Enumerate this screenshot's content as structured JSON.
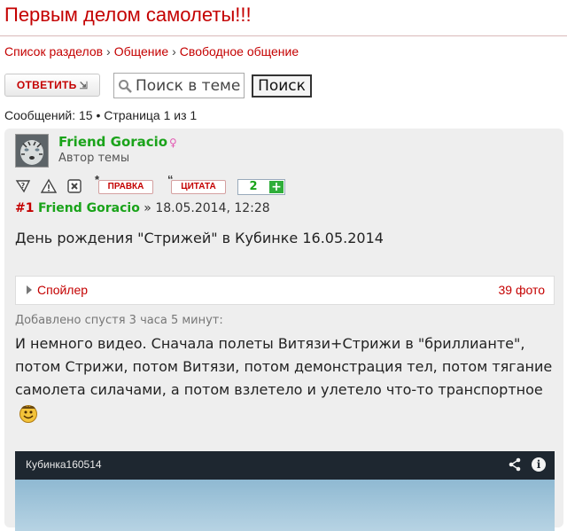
{
  "page": {
    "title": "Первым делом самолеты!!!"
  },
  "breadcrumb": {
    "items": [
      "Список разделов",
      "Общение",
      "Свободное общение"
    ],
    "separator": "›"
  },
  "toolbar": {
    "reply_label": "ОТВЕТИТЬ",
    "search_placeholder": "Поиск в теме...",
    "search_button": "Поиск"
  },
  "pagination": {
    "text": "Сообщений: 15 • Страница 1 из 1"
  },
  "post": {
    "author": "Friend Goracio",
    "gender_icon": "female-icon",
    "role": "Автор темы",
    "actions": {
      "edit_label": "ПРАВКА",
      "quote_label": "ЦИТАТА",
      "rating": "2",
      "rating_plus": "+"
    },
    "meta": {
      "number": "#1",
      "author": "Friend Goracio",
      "date": "» 18.05.2014, 12:28"
    },
    "text1": "День рождения \"Стрижей\" в Кубинке 16.05.2014",
    "spoiler": {
      "label": "Спойлер",
      "count": "39 фото"
    },
    "added_note": "Добавлено спустя 3 часа 5 минут:",
    "text2": "И немного видео. Сначала полеты Витязи+Стрижи в \"бриллианте\", потом Стрижи, потом Витязи, потом демонстрация тел, потом тягание самолета силачами, а потом взлетело и улетело что-то транспортное",
    "video": {
      "title": "Кубинка160514",
      "info_glyph": "i"
    }
  },
  "colors": {
    "accent": "#c40000",
    "author_green": "#1aa31a",
    "post_bg": "#eeeeee"
  }
}
